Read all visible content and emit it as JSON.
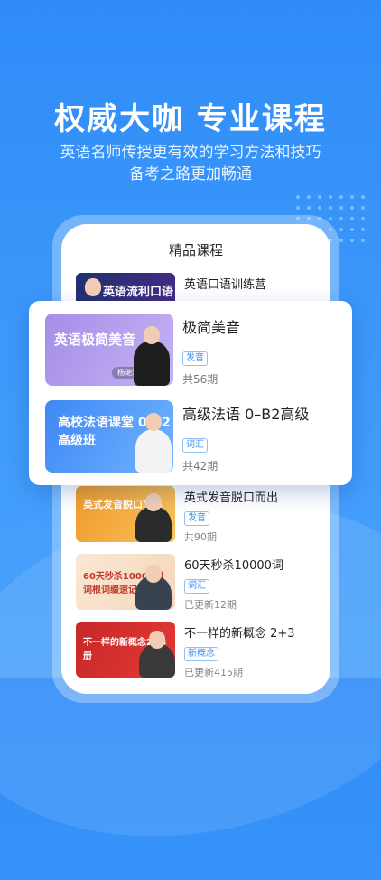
{
  "hero": {
    "headline": "权威大咖  专业课程",
    "subtitle_line1": "英语名师传授更有效的学习方法和技巧",
    "subtitle_line2": "备考之路更加畅通"
  },
  "phone": {
    "section_title": "精品课程",
    "courses": [
      {
        "title": "英语口语训练营",
        "thumb_text": "英语流利口语训练营",
        "tag": "",
        "meta": ""
      },
      {
        "title": "英式发音脱口而出",
        "thumb_text": "英式发音脱口而出",
        "tag": "发音",
        "meta": "共90期"
      },
      {
        "title": "60天秒杀10000词",
        "thumb_text": "60天秒杀10000词 词根词缀速记",
        "tag": "词汇",
        "meta": "已更新12期"
      },
      {
        "title": "不一样的新概念 2+3",
        "thumb_text": "不一样的新概念2+3册",
        "tag": "新概念",
        "meta": "已更新415期"
      }
    ]
  },
  "featured": [
    {
      "title": "极简美音",
      "thumb_text": "英语极简美音",
      "thumb_sub": "杨滟浔 ▶",
      "tag": "发音",
      "meta": "共56期"
    },
    {
      "title": "高级法语 0–B2高级",
      "thumb_text": "高校法语课堂 0-B2高级班",
      "tag": "词汇",
      "meta": "共42期"
    }
  ],
  "colors": {
    "background": "#2f8cf7",
    "tag_blue": "#3a8cf0",
    "accent_yellow": "#ffe44d"
  }
}
